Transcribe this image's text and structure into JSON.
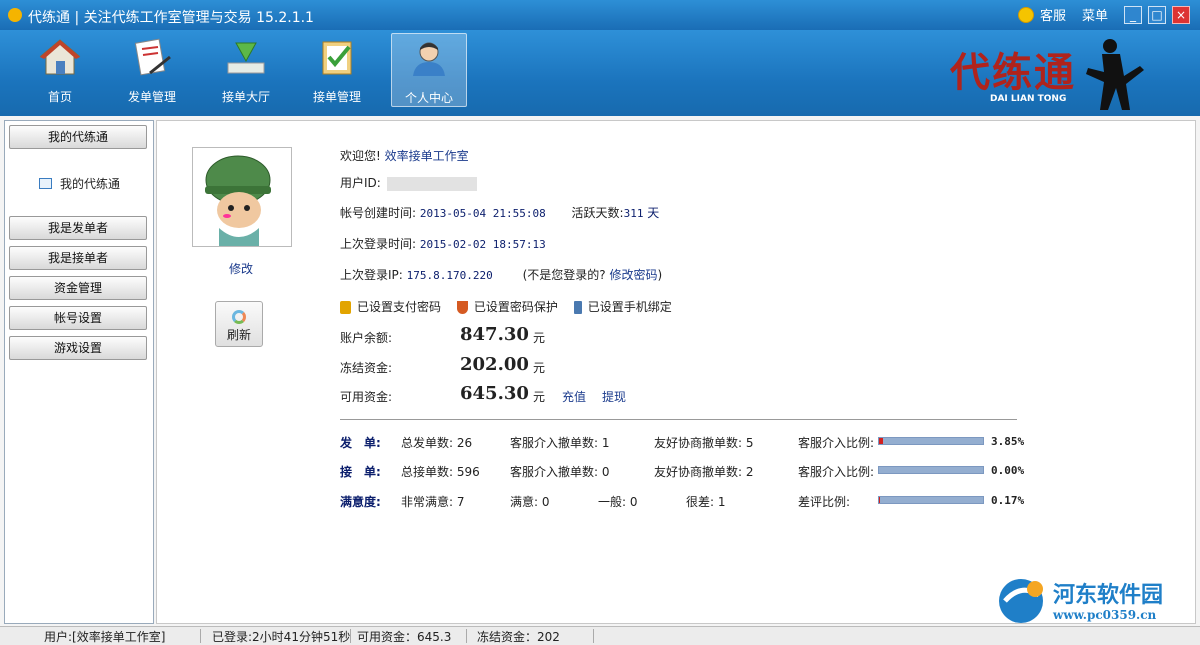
{
  "window": {
    "title": "代练通 | 关注代练工作室管理与交易 15.2.1.1",
    "service_label": "客服",
    "menu_label": "菜单"
  },
  "toolbar": {
    "items": [
      {
        "label": "首页",
        "icon": "home-icon"
      },
      {
        "label": "发单管理",
        "icon": "document-pen-icon"
      },
      {
        "label": "接单大厅",
        "icon": "download-arrow-icon"
      },
      {
        "label": "接单管理",
        "icon": "clipboard-check-icon"
      },
      {
        "label": "个人中心",
        "icon": "person-icon",
        "active": true
      }
    ],
    "logo_text": "代练通",
    "logo_sub": "DAI LIAN TONG"
  },
  "sidebar": {
    "header": "我的代练通",
    "sub_item": "我的代练通",
    "buttons": [
      "我是发单者",
      "我是接单者",
      "资金管理",
      "帐号设置",
      "游戏设置"
    ]
  },
  "profile": {
    "edit_label": "修改",
    "refresh_label": "刷新",
    "welcome_label": "欢迎您!",
    "studio_name": "效率接单工作室",
    "user_id_label": "用户ID:",
    "created_label": "帐号创建时间:",
    "created_value": "2013-05-04 21:55:08",
    "active_days_label": "活跃天数:",
    "active_days_value": "311",
    "day_unit": "天",
    "last_login_label": "上次登录时间:",
    "last_login_value": "2015-02-02 18:57:13",
    "last_ip_label": "上次登录IP:",
    "last_ip_value": "175.8.170.220",
    "not_you_text": "(不是您登录的?",
    "change_password": "修改密码",
    "not_you_close": ")",
    "security": [
      "已设置支付密码",
      "已设置密码保护",
      "已设置手机绑定"
    ]
  },
  "funds": {
    "balance_label": "账户余额:",
    "balance_value": "847.30",
    "frozen_label": "冻结资金:",
    "frozen_value": "202.00",
    "available_label": "可用资金:",
    "available_value": "645.30",
    "unit": "元",
    "recharge": "充值",
    "withdraw": "提现"
  },
  "stats": {
    "rows": [
      {
        "head": "发　单:",
        "c1_label": "总发单数:",
        "c1_value": "26",
        "c2_label": "客服介入撤单数:",
        "c2_value": "1",
        "c3_label": "友好协商撤单数:",
        "c3_value": "5",
        "ratio_label": "客服介入比例:",
        "ratio_value": "3.85%",
        "ratio": 0.0385
      },
      {
        "head": "接　单:",
        "c1_label": "总接单数:",
        "c1_value": "596",
        "c2_label": "客服介入撤单数:",
        "c2_value": "0",
        "c3_label": "友好协商撤单数:",
        "c3_value": "2",
        "ratio_label": "客服介入比例:",
        "ratio_value": "0.00%",
        "ratio": 0
      },
      {
        "head": "满意度:",
        "c1_label": "非常满意:",
        "c1_value": "7",
        "c2_label": "满意:",
        "c2_value": "0",
        "c3_label": "一般:",
        "c3_value": "0",
        "c4_label": "很差:",
        "c4_value": "1",
        "ratio_label": "差评比例:",
        "ratio_value": "0.17%",
        "ratio": 0.0017
      }
    ]
  },
  "statusbar": {
    "user": "用户:[效率接单工作室]",
    "logged_in": "已登录:2小时41分钟51秒",
    "available": "可用资金：645.3",
    "frozen": "冻结资金：202"
  },
  "watermark": {
    "title": "河东软件园",
    "url": "www.pc0359.cn"
  }
}
